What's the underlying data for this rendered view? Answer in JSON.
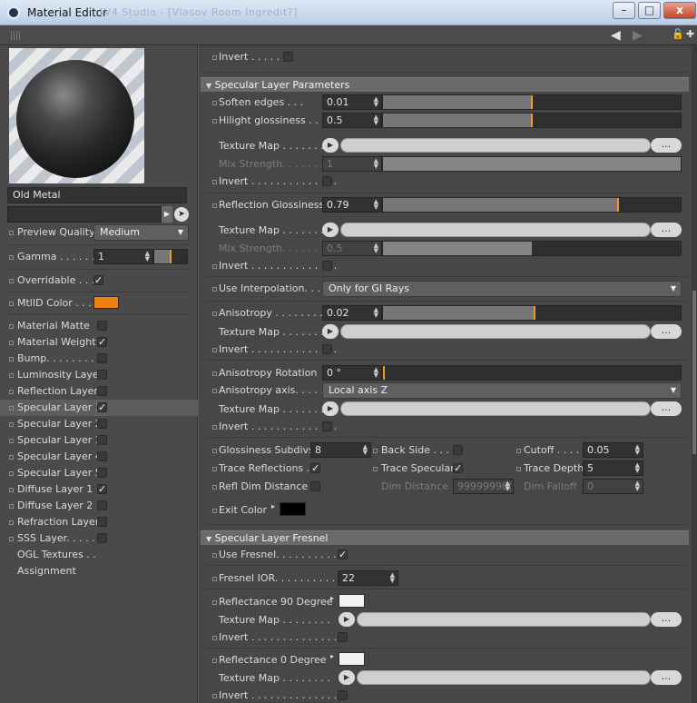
{
  "window": {
    "title": "Material Editor",
    "blurred_title": "[V4 Studio - [Vlasov Room Ingredit?]",
    "btn_min": "–",
    "btn_max": "□",
    "btn_close": "x"
  },
  "toolbar": {
    "back": "◀",
    "forward": "▶",
    "lock": "🔓",
    "new": "✚"
  },
  "material": {
    "name": "Old Metal",
    "preview_quality_label": "Preview Quality",
    "preview_quality": "Medium",
    "gamma_label": "Gamma . . . . . .",
    "gamma": "1",
    "overridable_label": "Overridable . . .",
    "mtlid_label": "MtlID Color . . .",
    "mtlid_color": "#f07f12"
  },
  "channels": [
    {
      "label": "Material Matte",
      "checked": ""
    },
    {
      "label": "Material Weight",
      "checked": "✓"
    },
    {
      "label": "Bump. . . . . . . . .",
      "checked": ""
    },
    {
      "label": "Luminosity Layer",
      "checked": ""
    },
    {
      "label": "Reflection Layer",
      "checked": ""
    },
    {
      "label": "Specular Layer 1",
      "checked": "✓"
    },
    {
      "label": "Specular Layer 2",
      "checked": ""
    },
    {
      "label": "Specular Layer 3",
      "checked": ""
    },
    {
      "label": "Specular Layer 4",
      "checked": ""
    },
    {
      "label": "Specular Layer 5",
      "checked": ""
    },
    {
      "label": "Diffuse Layer 1",
      "checked": "✓"
    },
    {
      "label": "Diffuse Layer 2",
      "checked": ""
    },
    {
      "label": "Refraction Layer",
      "checked": ""
    },
    {
      "label": "SSS Layer. . . . .",
      "checked": ""
    }
  ],
  "extra_items": [
    "OGL Textures . .",
    "Assignment"
  ],
  "params": {
    "invert": "Invert . . . . . .",
    "invert_long": "Invert . . . . . . . . . . . . . .",
    "section_params": "Specular Layer Parameters",
    "soften_label": "Soften edges . . .",
    "soften": "0.01",
    "soften_level": 0.5,
    "hilight_label": "Hilight glossiness . .",
    "hilight": "0.5",
    "hilight_level": 0.5,
    "texture_map": "Texture Map . . . . . . . .",
    "mix_strength": "Mix Strength. . . . . . .",
    "mix1": "1",
    "mix1_level": 1.0,
    "refl_gloss_label": "Reflection Glossiness",
    "refl_gloss": "0.79",
    "refl_gloss_level": 0.79,
    "mix2": "0.5",
    "mix2_level": 0.5,
    "use_interp_label": "Use Interpolation. . . . . .",
    "use_interp": "Only for GI Rays",
    "aniso_label": "Anisotropy . . . . . . . .",
    "aniso": "0.02",
    "aniso_level": 0.51,
    "aniso_rot_label": "Anisotropy Rotation",
    "aniso_rot": "0 °",
    "aniso_rot_level": 0.0,
    "aniso_axis_label": "Anisotropy axis. . . . .",
    "aniso_axis": "Local axis Z",
    "gloss_subdivs_label": "Glossiness Subdivs",
    "gloss_subdivs": "8",
    "back_side_label": "Back Side . . . .",
    "cutoff_label": "Cutoff . . . . .",
    "cutoff": "0.05",
    "trace_refl_label": "Trace Reflections . .",
    "trace_spec_label": "Trace Specular",
    "trace_depth_label": "Trace Depth",
    "trace_depth": "5",
    "refl_dim_label": "Refl Dim Distance",
    "dim_distance_label": "Dim Distance",
    "dim_distance": "99999998(",
    "dim_falloff_label": "Dim Falloff",
    "dim_falloff": "0",
    "exit_color_label": "Exit Color",
    "section_fresnel": "Specular Layer Fresnel",
    "use_fresnel_label": "Use Fresnel. . . . . . . . . . .",
    "fresnel_ior_label": "Fresnel IOR. . . . . . . . . . .",
    "fresnel_ior": "22",
    "refl90_label": "Reflectance 90 Degree",
    "refl0_label": "Reflectance  0 Degree",
    "check": "✓",
    "dots": "...",
    "play": "▶",
    "deg_arrow": "▸"
  }
}
